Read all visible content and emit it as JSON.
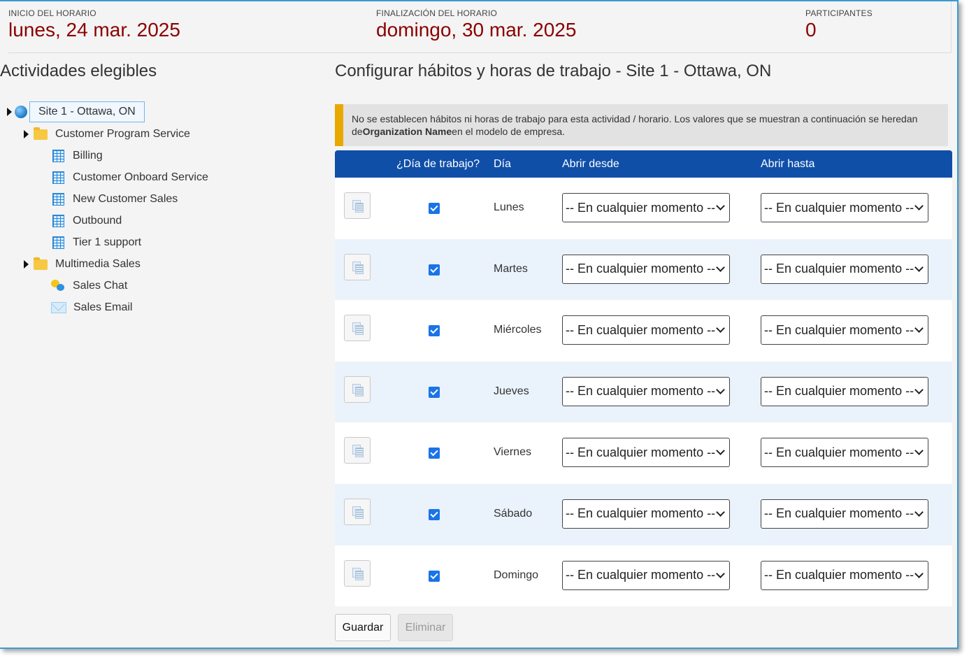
{
  "header": {
    "start": {
      "label": "INICIO DEL HORARIO",
      "value": "lunes, 24 mar. 2025"
    },
    "end": {
      "label": "FINALIZACIÓN DEL HORARIO",
      "value": "domingo, 30 mar. 2025"
    },
    "participants": {
      "label": "PARTICIPANTES",
      "value": "0"
    }
  },
  "left": {
    "title": "Actividades elegibles",
    "tree": {
      "site": "Site 1 - Ottawa, ON",
      "cps": "Customer Program Service",
      "billing": "Billing",
      "onboard": "Customer Onboard Service",
      "newsales": "New Customer Sales",
      "outbound": "Outbound",
      "tier1": "Tier 1 support",
      "multimedia": "Multimedia Sales",
      "chat": "Sales Chat",
      "email": "Sales Email"
    }
  },
  "right": {
    "title": "Configurar hábitos y horas de trabajo - Site 1 - Ottawa, ON",
    "notice": {
      "text1": "No se establecen hábitos ni horas de trabajo para esta actividad / horario. Los valores que se muestran a continuación se heredan de",
      "bold": "Organization Name",
      "text2": "en el modelo de empresa."
    },
    "table": {
      "headers": {
        "workday": "¿Día de trabajo?",
        "day": "Día",
        "open_from": "Abrir desde",
        "open_to": "Abrir hasta"
      },
      "rows": [
        {
          "day": "Lunes",
          "from": "-- En cualquier momento --",
          "to": "-- En cualquier momento --",
          "checked": true
        },
        {
          "day": "Martes",
          "from": "-- En cualquier momento --",
          "to": "-- En cualquier momento --",
          "checked": true
        },
        {
          "day": "Miércoles",
          "from": "-- En cualquier momento --",
          "to": "-- En cualquier momento --",
          "checked": true
        },
        {
          "day": "Jueves",
          "from": "-- En cualquier momento --",
          "to": "-- En cualquier momento --",
          "checked": true
        },
        {
          "day": "Viernes",
          "from": "-- En cualquier momento --",
          "to": "-- En cualquier momento --",
          "checked": true
        },
        {
          "day": "Sábado",
          "from": "-- En cualquier momento --",
          "to": "-- En cualquier momento --",
          "checked": true
        },
        {
          "day": "Domingo",
          "from": "-- En cualquier momento --",
          "to": "-- En cualquier momento --",
          "checked": true
        }
      ]
    },
    "buttons": {
      "save": "Guardar",
      "delete": "Eliminar"
    }
  },
  "colors": {
    "accent_header": "#0f4fa8",
    "date_red": "#8b0000",
    "notice_bar": "#e8a800",
    "row_alt": "#eaf2fb"
  }
}
